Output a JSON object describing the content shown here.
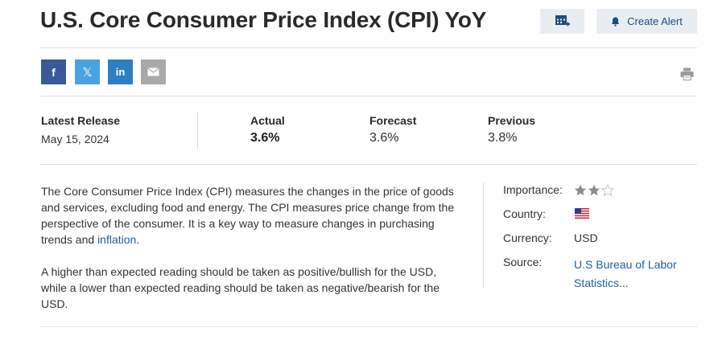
{
  "page": {
    "title": "U.S. Core Consumer Price Index (CPI) YoY",
    "create_alert_label": "Create Alert"
  },
  "release": {
    "latest_release_label": "Latest Release",
    "latest_release_date": "May 15, 2024",
    "actual_label": "Actual",
    "actual_value": "3.6%",
    "forecast_label": "Forecast",
    "forecast_value": "3.6%",
    "previous_label": "Previous",
    "previous_value": "3.8%"
  },
  "description": {
    "p1_text": "The Core Consumer Price Index (CPI) measures the changes in the price of goods and services, excluding food and energy. The CPI measures price change from the perspective of the consumer. It is a key way to measure changes in purchasing trends and ",
    "p1_link": "inflation",
    "p1_end": ".",
    "p2": "A higher than expected reading should be taken as positive/bullish for the USD, while a lower than expected reading should be taken as negative/bearish for the USD."
  },
  "meta": {
    "importance_label": "Importance:",
    "importance_stars": 2,
    "importance_max": 3,
    "country_label": "Country:",
    "country_flag": "us-flag-icon",
    "currency_label": "Currency:",
    "currency_value": "USD",
    "source_label": "Source:",
    "source_value_line1": "U.S Bureau of Labor",
    "source_value_line2": "Statistics..."
  },
  "social": {
    "facebook": "f",
    "twitter": "𝕏",
    "linkedin": "in"
  },
  "colors": {
    "facebook": "#3b5998",
    "twitter": "#4aa3df",
    "linkedin": "#2f7fc0",
    "email": "#a9a9a9",
    "link": "#1f5ea8",
    "star_filled": "#8c8c8c",
    "star_empty": "#c8c8c8"
  }
}
